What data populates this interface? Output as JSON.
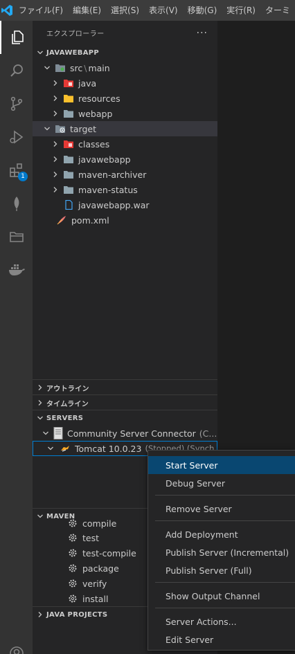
{
  "menubar": {
    "items": [
      "ファイル(F)",
      "編集(E)",
      "選択(S)",
      "表示(V)",
      "移動(G)",
      "実行(R)",
      "ターミ"
    ]
  },
  "activity_bar": {
    "icons": [
      "files-icon",
      "search-icon",
      "source-control-icon",
      "run-debug-icon",
      "extensions-icon",
      "mongodb-leaf-icon",
      "folder-icon",
      "docker-icon",
      "account-icon"
    ],
    "extensions_badge": "1"
  },
  "explorer": {
    "title": "エクスプローラー",
    "more": "···",
    "project": "JAVAWEBAPP",
    "tree": [
      {
        "label": "src",
        "suffix": "main",
        "indent": 1,
        "expanded": true,
        "icon": "folder-src"
      },
      {
        "label": "java",
        "indent": 2,
        "expanded": false,
        "icon": "folder-java"
      },
      {
        "label": "resources",
        "indent": 2,
        "expanded": false,
        "icon": "folder-resources"
      },
      {
        "label": "webapp",
        "indent": 2,
        "expanded": false,
        "icon": "folder-gray"
      },
      {
        "label": "target",
        "indent": 1,
        "expanded": true,
        "icon": "folder-target"
      },
      {
        "label": "classes",
        "indent": 2,
        "expanded": false,
        "icon": "folder-classes"
      },
      {
        "label": "javawebapp",
        "indent": 2,
        "expanded": false,
        "icon": "folder-gray"
      },
      {
        "label": "maven-archiver",
        "indent": 2,
        "expanded": false,
        "icon": "folder-gray"
      },
      {
        "label": "maven-status",
        "indent": 2,
        "expanded": false,
        "icon": "folder-gray"
      },
      {
        "label": "javawebapp.war",
        "indent": 2,
        "icon": "file-war"
      },
      {
        "label": "pom.xml",
        "indent": 1,
        "icon": "file-pom"
      }
    ]
  },
  "sections": {
    "outline": "アウトライン",
    "timeline": "タイムライン",
    "servers": "SERVERS",
    "maven": "MAVEN",
    "java_projects": "JAVA PROJECTS"
  },
  "servers": {
    "connector": "Community Server Connector",
    "connector_suffix": "(C...",
    "tomcat": "Tomcat 10.0.23",
    "tomcat_status": "(Stopped) (Synch..."
  },
  "maven": {
    "lifecycle": [
      "compile",
      "test",
      "test-compile",
      "package",
      "verify",
      "install"
    ]
  },
  "context_menu": {
    "items": [
      "Start Server",
      "Debug Server",
      "Remove Server",
      "Add Deployment",
      "Publish Server (Incremental)",
      "Publish Server (Full)",
      "Show Output Channel",
      "Server Actions...",
      "Edit Server"
    ],
    "highlighted": "Start Server"
  },
  "colors": {
    "accent": "#007acc",
    "menu_highlight": "#094771",
    "focus_border": "#007fd4"
  }
}
